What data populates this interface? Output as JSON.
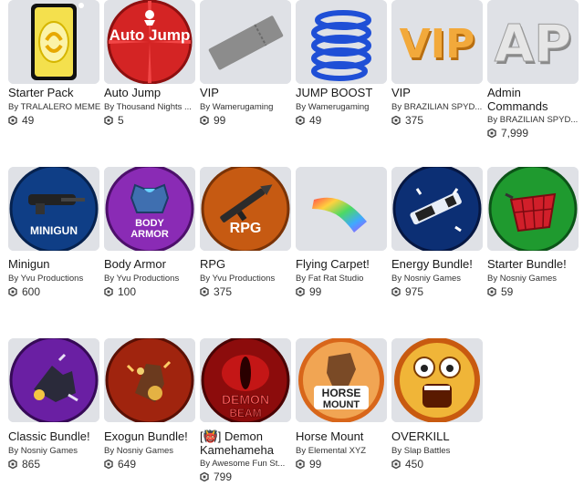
{
  "items": [
    {
      "name": "Starter Pack",
      "creator_prefix": "By",
      "creator": "TRALALERO MEME",
      "price": "49",
      "icon": "starter-pack-card-icon"
    },
    {
      "name": "Auto Jump",
      "creator_prefix": "By",
      "creator": "Thousand Nights ...",
      "price": "5",
      "icon": "auto-jump-icon",
      "art_text": "Auto Jump"
    },
    {
      "name": "VIP",
      "creator_prefix": "By",
      "creator": "Wamerugaming",
      "price": "99",
      "icon": "ticket-icon"
    },
    {
      "name": "JUMP BOOST",
      "creator_prefix": "By",
      "creator": "Wamerugaming",
      "price": "49",
      "icon": "spring-icon"
    },
    {
      "name": "VIP",
      "creator_prefix": "By",
      "creator": "BRAZILIAN SPYD...",
      "price": "375",
      "icon": "vip-letters-icon",
      "art_text": "VIP"
    },
    {
      "name": "Admin Commands",
      "creator_prefix": "By",
      "creator": "BRAZILIAN SPYD...",
      "price": "7,999",
      "icon": "admin-letters-icon",
      "art_text": "AP"
    },
    {
      "name": "Minigun",
      "creator_prefix": "By",
      "creator": "Yvu Productions",
      "price": "600",
      "icon": "minigun-icon",
      "art_text": "MINIGUN"
    },
    {
      "name": "Body Armor",
      "creator_prefix": "By",
      "creator": "Yvu Productions",
      "price": "100",
      "icon": "body-armor-icon",
      "art_text": "BODY ARMOR"
    },
    {
      "name": "RPG",
      "creator_prefix": "By",
      "creator": "Yvu Productions",
      "price": "375",
      "icon": "rpg-icon",
      "art_text": "RPG"
    },
    {
      "name": "Flying Carpet!",
      "creator_prefix": "By",
      "creator": "Fat Rat Studio",
      "price": "99",
      "icon": "flying-carpet-icon"
    },
    {
      "name": "Energy Bundle!",
      "creator_prefix": "By",
      "creator": "Nosniy Games",
      "price": "975",
      "icon": "energy-bundle-icon"
    },
    {
      "name": "Starter Bundle!",
      "creator_prefix": "By",
      "creator": "Nosniy Games",
      "price": "59",
      "icon": "starter-bundle-basket-icon"
    },
    {
      "name": "Classic Bundle!",
      "creator_prefix": "By",
      "creator": "Nosniy Games",
      "price": "865",
      "icon": "classic-bundle-icon"
    },
    {
      "name": "Exogun Bundle!",
      "creator_prefix": "By",
      "creator": "Nosniy Games",
      "price": "649",
      "icon": "exogun-bundle-icon"
    },
    {
      "name": "[👹] Demon Kamehameha",
      "creator_prefix": "By",
      "creator": "Awesome Fun St...",
      "price": "799",
      "icon": "demon-beam-icon",
      "art_text": "DEMON BEAM"
    },
    {
      "name": "Horse Mount",
      "creator_prefix": "By",
      "creator": "Elemental XYZ",
      "price": "99",
      "icon": "horse-mount-icon",
      "art_text": "HORSE MOUNT"
    },
    {
      "name": "OVERKILL",
      "creator_prefix": "By",
      "creator": "Slap Battles",
      "price": "450",
      "icon": "overkill-face-icon"
    }
  ],
  "currency_icon": "robux-icon"
}
